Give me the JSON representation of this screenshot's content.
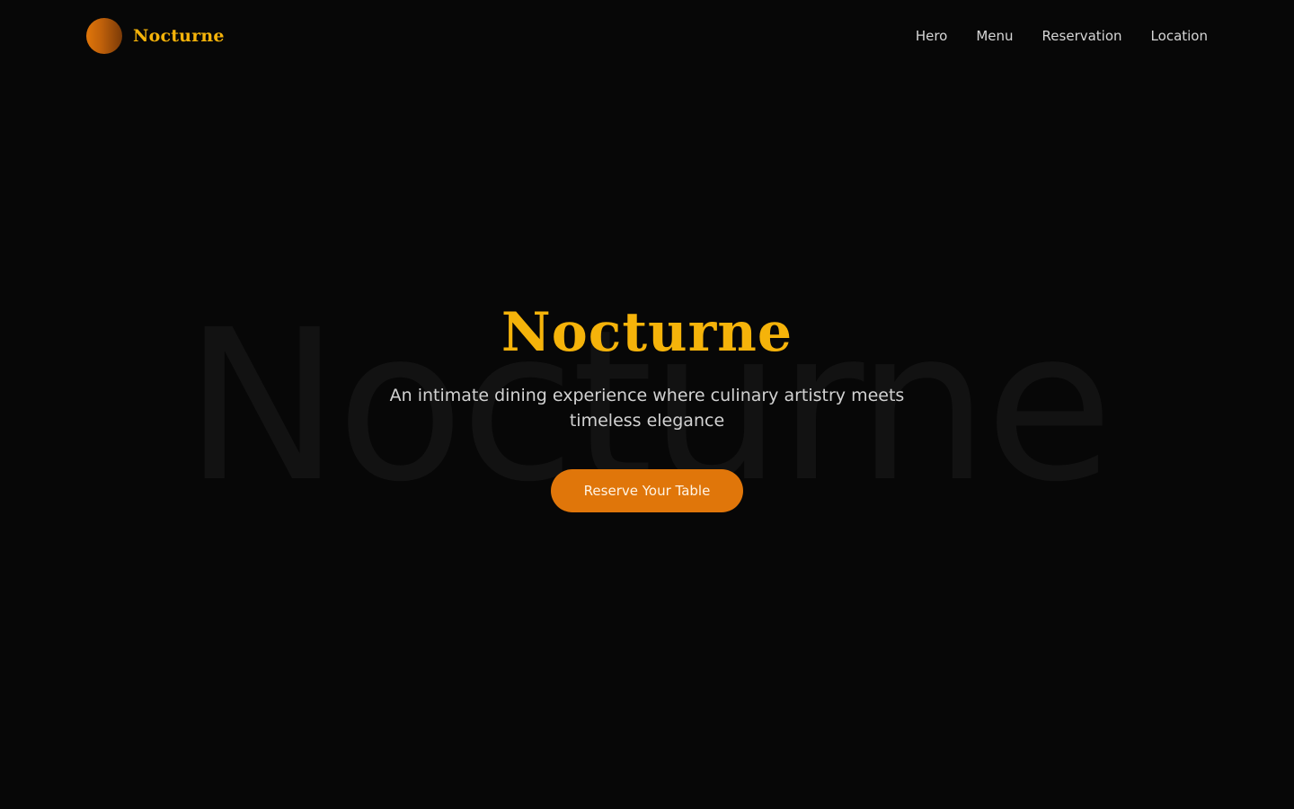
{
  "header": {
    "brand_name": "Nocturne",
    "logo_icon": "orb-logo-icon",
    "nav": [
      {
        "label": "Hero"
      },
      {
        "label": "Menu"
      },
      {
        "label": "Reservation"
      },
      {
        "label": "Location"
      }
    ]
  },
  "hero": {
    "watermark": "Nocturne",
    "title": "Nocturne",
    "tagline": "An intimate dining experience where culinary artistry meets timeless elegance",
    "cta_label": "Reserve Your Table"
  },
  "colors": {
    "background": "#070707",
    "accent_gold": "#f5b30a",
    "accent_orange": "#e0760a",
    "text_muted": "#d2d2d2"
  }
}
